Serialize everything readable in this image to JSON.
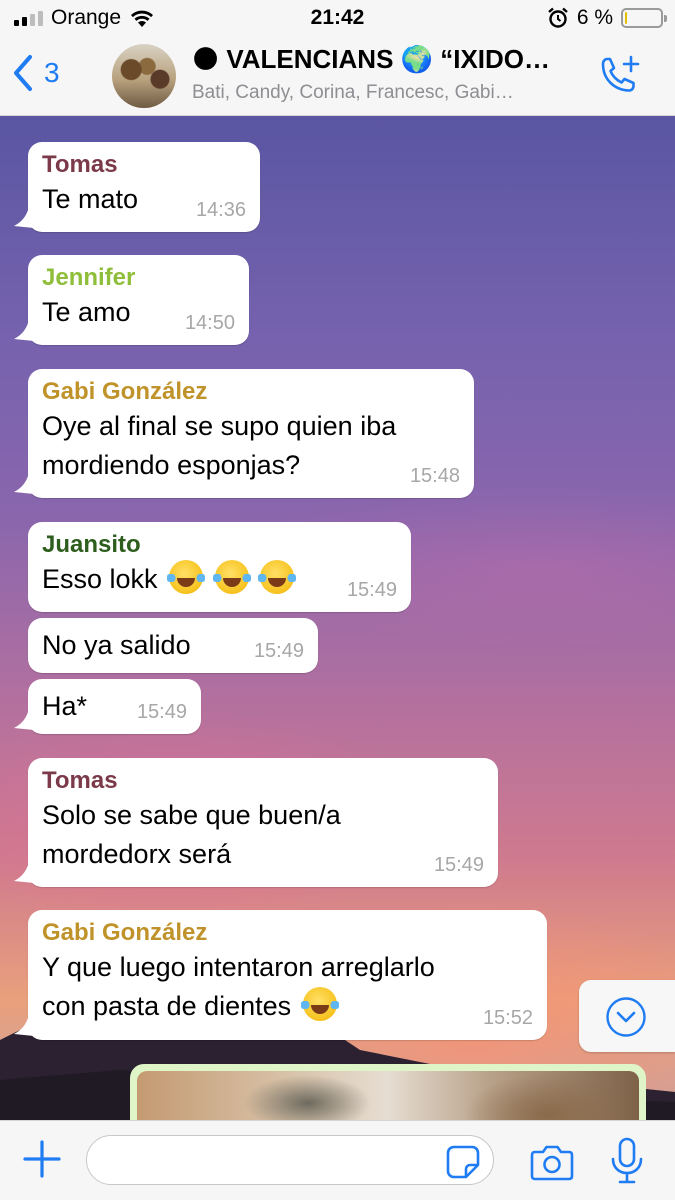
{
  "status_bar": {
    "carrier": "Orange",
    "time": "21:42",
    "battery_percent": "6 %",
    "battery_level": 0.06,
    "icons": [
      "signal-icon",
      "wifi-icon",
      "alarm-icon",
      "battery-icon"
    ]
  },
  "header": {
    "back_count": "3",
    "title": "🌑 VALENCIANS 🌍 “IXIDO…",
    "subtitle": "Bati, Candy, Corina, Francesc, Gabi…",
    "icons": [
      "back-chevron-icon",
      "add-call-icon"
    ]
  },
  "colors": {
    "accent": "#1f7cf3",
    "tomas": "#7b3a4a",
    "jennifer": "#8fbf3a",
    "gabi": "#c0922a",
    "juansito": "#2e5e1e",
    "outgoing": "#dff5c8"
  },
  "messages": [
    {
      "sender": "Tomas",
      "text": "Te mato",
      "time": "14:36"
    },
    {
      "sender": "Jennifer",
      "text": "Te amo",
      "time": "14:50"
    },
    {
      "sender": "Gabi González",
      "line1": "Oye al final se supo quien iba",
      "line2": "mordiendo esponjas?",
      "time": "15:48"
    },
    {
      "sender": "Juansito",
      "text": "Esso lokk",
      "emoji_count": 3,
      "time": "15:49"
    },
    {
      "text": "No ya salido",
      "time": "15:49"
    },
    {
      "text": "Ha*",
      "time": "15:49"
    },
    {
      "sender": "Tomas",
      "line1": "Solo se sabe que buen/a",
      "line2": "mordedorx será",
      "time": "15:49"
    },
    {
      "sender": "Gabi González",
      "line1": "Y que luego intentaron arreglarlo",
      "line2": "con pasta de dientes",
      "emoji_count": 1,
      "time": "15:52"
    }
  ],
  "composer": {
    "placeholder": "",
    "icons": [
      "plus-icon",
      "sticker-icon",
      "camera-icon",
      "microphone-icon"
    ]
  }
}
